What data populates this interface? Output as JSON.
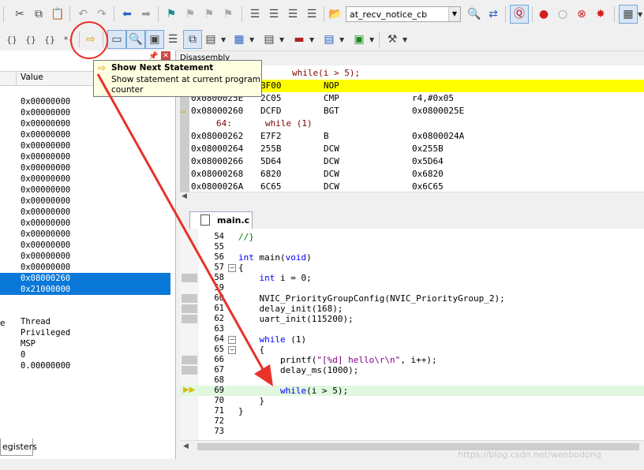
{
  "toolbar": {
    "function_combo": "at_recv_notice_cb"
  },
  "tooltip": {
    "title": "Show Next Statement",
    "description": "Show statement at current program counter"
  },
  "registers": {
    "header_value": "Value",
    "tab_label": "egisters",
    "values": [
      "0x00000000",
      "0x00000000",
      "0x00000000",
      "0x00000000",
      "0x00000000",
      "0x00000000",
      "0x00000000",
      "0x00000000",
      "0x00000000",
      "0x00000000",
      "0x00000000",
      "0x00000000",
      "0x00000000",
      "0x00000000",
      "0x00000000",
      "0x00000000"
    ],
    "highlighted": [
      "0x08000260",
      "0x21000000"
    ],
    "mode_label": "e",
    "mode_value": "Thread",
    "privilege": "Privileged",
    "stack": "MSP",
    "num": "0",
    "float": "0.00000000"
  },
  "disassembly": {
    "title": "Disassembly",
    "lines": [
      {
        "addr": "",
        "code": "",
        "mnem": "while(i > 5);",
        "operand": "",
        "type": "src_hidden"
      },
      {
        "addr": "",
        "code": "BF00",
        "mnem": "NOP",
        "operand": "",
        "type": "current"
      },
      {
        "addr": "0x0800025E",
        "code": "2C05",
        "mnem": "CMP",
        "operand": "r4,#0x05",
        "type": "normal"
      },
      {
        "addr": "0x08000260",
        "code": "DCFD",
        "mnem": "BGT",
        "operand": "0x0800025E",
        "type": "pc"
      },
      {
        "addr": "64:",
        "code": "",
        "mnem": "while (1)",
        "operand": "",
        "type": "src"
      },
      {
        "addr": "0x08000262",
        "code": "E7F2",
        "mnem": "B",
        "operand": "0x0800024A",
        "type": "normal"
      },
      {
        "addr": "0x08000264",
        "code": "255B",
        "mnem": "DCW",
        "operand": "0x255B",
        "type": "normal"
      },
      {
        "addr": "0x08000266",
        "code": "5D64",
        "mnem": "DCW",
        "operand": "0x5D64",
        "type": "normal"
      },
      {
        "addr": "0x08000268",
        "code": "6820",
        "mnem": "DCW",
        "operand": "0x6820",
        "type": "normal"
      },
      {
        "addr": "0x0800026A",
        "code": "6C65",
        "mnem": "DCW",
        "operand": "0x6C65",
        "type": "normal"
      }
    ]
  },
  "editor": {
    "tab": "main.c",
    "lines": [
      {
        "n": "54",
        "code": "//}"
      },
      {
        "n": "55",
        "code": ""
      },
      {
        "n": "56",
        "code": "int main(void)"
      },
      {
        "n": "57",
        "code": "{"
      },
      {
        "n": "58",
        "code": "    int i = 0;"
      },
      {
        "n": "59",
        "code": ""
      },
      {
        "n": "60",
        "code": "    NVIC_PriorityGroupConfig(NVIC_PriorityGroup_2);"
      },
      {
        "n": "61",
        "code": "    delay_init(168);"
      },
      {
        "n": "62",
        "code": "    uart_init(115200);"
      },
      {
        "n": "63",
        "code": ""
      },
      {
        "n": "64",
        "code": "    while (1)"
      },
      {
        "n": "65",
        "code": "    {"
      },
      {
        "n": "66",
        "code": "        printf(\"[%d] hello\\r\\n\", i++);"
      },
      {
        "n": "67",
        "code": "        delay_ms(1000);"
      },
      {
        "n": "68",
        "code": ""
      },
      {
        "n": "69",
        "code": "        while(i > 5);"
      },
      {
        "n": "70",
        "code": "    }"
      },
      {
        "n": "71",
        "code": "}"
      },
      {
        "n": "72",
        "code": ""
      },
      {
        "n": "73",
        "code": ""
      }
    ]
  },
  "watermark": "https://blog.csdn.net/wenbodong",
  "colors": {
    "current_line": "#ffff00",
    "pc_line": "#e0f7e0",
    "selection": "#0a78d7",
    "annotation": "#e8322a"
  }
}
